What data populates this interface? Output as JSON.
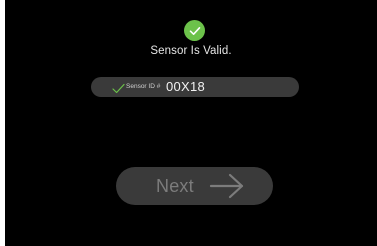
{
  "status": {
    "icon": "check-circle-icon",
    "badge_color": "#6cc24a",
    "text": "Sensor Is Valid."
  },
  "sensor": {
    "check_icon": "checkmark-icon",
    "check_color": "#6cc24a",
    "label": "Sensor ID #",
    "value": "00X18"
  },
  "next_button": {
    "label": "Next",
    "icon": "arrow-right-icon"
  }
}
